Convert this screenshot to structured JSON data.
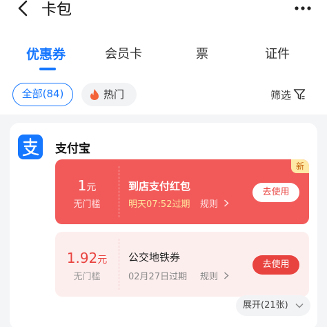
{
  "header": {
    "title": "卡包"
  },
  "tabs": [
    {
      "label": "优惠券",
      "active": true
    },
    {
      "label": "会员卡",
      "active": false
    },
    {
      "label": "票",
      "active": false
    },
    {
      "label": "证件",
      "active": false
    }
  ],
  "filters": {
    "all_label": "全部(84)",
    "hot_label": "热门",
    "filter_label": "筛选"
  },
  "merchant": {
    "name": "支付宝"
  },
  "coupons": [
    {
      "amount": "1",
      "unit": "元",
      "condition": "无门槛",
      "name": "到店支付红包",
      "expire": "明天07:52过期",
      "rules": "规则",
      "action": "去使用",
      "badge": "新"
    },
    {
      "amount": "1.92",
      "unit": "元",
      "condition": "无门槛",
      "name": "公交地铁券",
      "expire": "02月27日过期",
      "rules": "规则",
      "action": "去使用"
    }
  ],
  "expand_label": "展开(21张)",
  "colors": {
    "accent": "#1677ff",
    "coupon_red": "#f25a5a",
    "button_red": "#e8433f"
  }
}
